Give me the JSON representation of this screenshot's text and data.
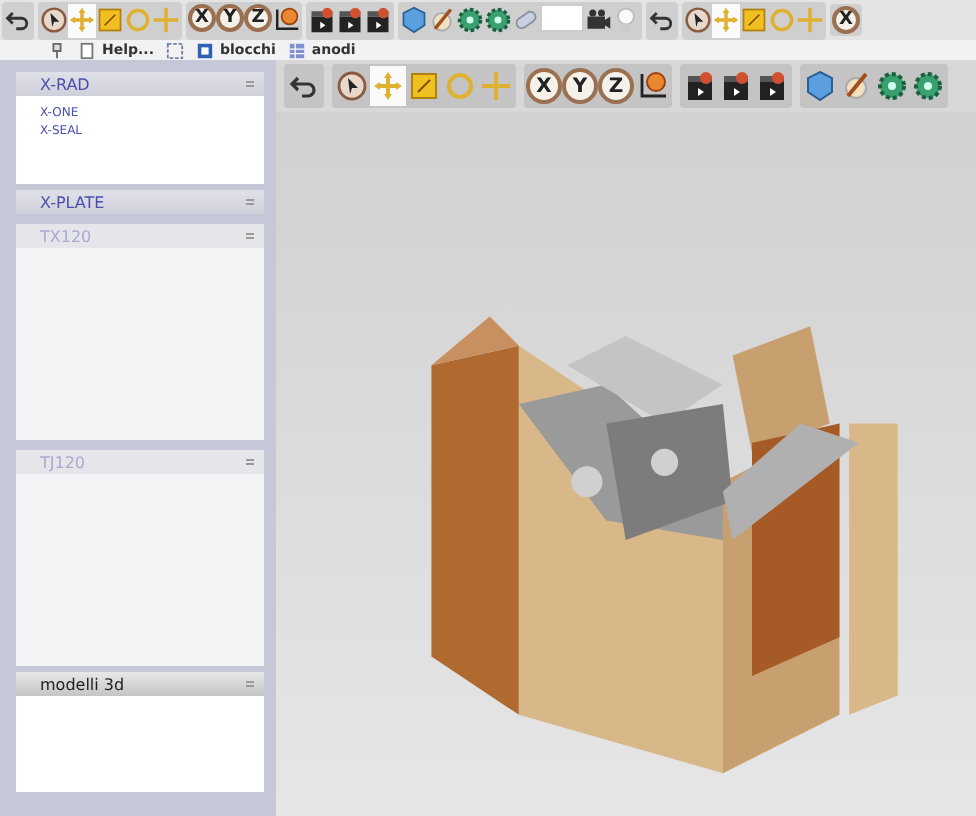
{
  "top_toolbar": [
    [
      {
        "kind": "undo"
      }
    ],
    [
      {
        "kind": "cursor",
        "selected": false
      },
      {
        "kind": "move",
        "selected": true
      },
      {
        "kind": "scale",
        "selected": false
      },
      {
        "kind": "rotate",
        "selected": false
      },
      {
        "kind": "cross",
        "selected": false
      }
    ],
    [
      {
        "kind": "axis",
        "label": "X"
      },
      {
        "kind": "axis",
        "label": "Y"
      },
      {
        "kind": "axis",
        "label": "Z"
      },
      {
        "kind": "gizmo"
      }
    ],
    [
      {
        "kind": "clapper"
      },
      {
        "kind": "clapper"
      },
      {
        "kind": "clapper"
      }
    ],
    [
      {
        "kind": "cube"
      },
      {
        "kind": "brush"
      },
      {
        "kind": "gear"
      },
      {
        "kind": "gear"
      },
      {
        "kind": "pill"
      },
      {
        "kind": "blank"
      },
      {
        "kind": "camera"
      },
      {
        "kind": "bulb"
      }
    ],
    [
      {
        "kind": "undo"
      }
    ],
    [
      {
        "kind": "cursor",
        "selected": false
      },
      {
        "kind": "move",
        "selected": true
      },
      {
        "kind": "scale",
        "selected": false
      },
      {
        "kind": "rotate",
        "selected": false
      },
      {
        "kind": "cross",
        "selected": false
      }
    ],
    [
      {
        "kind": "axis",
        "label": "X"
      }
    ]
  ],
  "tabs_bar": [
    {
      "kind": "pin"
    },
    {
      "kind": "page",
      "label": "Help..."
    },
    {
      "kind": "frame"
    },
    {
      "kind": "book",
      "label": "blocchi"
    },
    {
      "kind": "grid",
      "label": "anodi"
    }
  ],
  "library": [
    {
      "title": "X-RAD",
      "kind": "category",
      "items": [
        "X-ONE",
        "X-SEAL"
      ]
    },
    {
      "title": "X-PLATE",
      "kind": "category"
    },
    {
      "title": "TX120",
      "kind": "faded"
    },
    {
      "title": "TJ120",
      "kind": "faded"
    },
    {
      "title": "modelli 3d",
      "kind": "plain"
    }
  ],
  "viewport_toolbar": [
    [
      {
        "kind": "undo"
      }
    ],
    [
      {
        "kind": "cursor",
        "selected": false
      },
      {
        "kind": "move",
        "selected": true
      },
      {
        "kind": "scale",
        "selected": false
      },
      {
        "kind": "rotate",
        "selected": false
      },
      {
        "kind": "cross",
        "selected": false
      }
    ],
    [
      {
        "kind": "axis",
        "label": "X"
      },
      {
        "kind": "axis",
        "label": "Y"
      },
      {
        "kind": "axis",
        "label": "Z"
      },
      {
        "kind": "gizmo"
      }
    ],
    [
      {
        "kind": "clapper"
      },
      {
        "kind": "clapper"
      },
      {
        "kind": "clapper"
      }
    ],
    [
      {
        "kind": "cube"
      },
      {
        "kind": "brush"
      },
      {
        "kind": "gear"
      },
      {
        "kind": "gear"
      }
    ]
  ]
}
